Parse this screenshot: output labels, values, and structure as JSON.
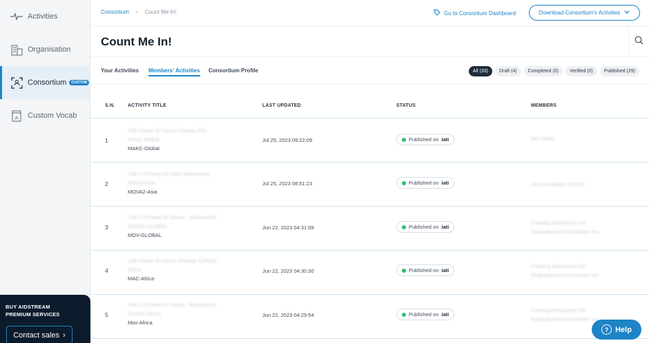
{
  "sidebar": {
    "items": [
      {
        "label": "Activities",
        "icon": "activity-pulse-icon"
      },
      {
        "label": "Organisation",
        "icon": "building-icon"
      },
      {
        "label": "Consortium",
        "icon": "consortium-icon",
        "badge": "CUSTOM",
        "active": true
      },
      {
        "label": "Custom Vocab",
        "icon": "vocab-book-icon"
      }
    ],
    "promo": {
      "title_line1": "BUY AIDSTREAM",
      "title_line2": "PREMIUM SERVICES",
      "button": "Contact sales"
    }
  },
  "header": {
    "breadcrumb": {
      "parent": "Consortium",
      "separator": "›",
      "current": "Count Me In!"
    },
    "dashboard_link": "Go to Consortium Dashboard",
    "download_button": "Download Consortium's Activities",
    "title": "Count Me In!"
  },
  "tabs": [
    "Your Activities",
    "Members' Activities",
    "Consortium Profile"
  ],
  "active_tab": "Members' Activities",
  "filters": [
    {
      "label": "All (33)",
      "active": true
    },
    {
      "label": "Draft (4)"
    },
    {
      "label": "Completed (0)"
    },
    {
      "label": "Verified (0)"
    },
    {
      "label": "Published (29)"
    }
  ],
  "table": {
    "columns": [
      "S.N.",
      "ACTIVITY TITLE",
      "LAST UPDATED",
      "STATUS",
      "MEMBERS"
    ],
    "rows": [
      {
        "sn": "1",
        "title_line1": "CMI Power of Voices-Change (Mo-",
        "title_line2": "mem)- Global",
        "identifier": "MAKC-Global",
        "updated": "Jul 25, 2023 09:22:09",
        "status": "Published on",
        "status_source": "iati",
        "member_line1": "WO-NWN",
        "member_line2": ""
      },
      {
        "sn": "2",
        "title_line1": "CMI 2.0 Power of Voice Movements",
        "title_line2": "(MOV)-Asia",
        "identifier": "MOVA2-Asia",
        "updated": "Jul 25, 2023 08:51:23",
        "status": "Published on",
        "status_source": "iati",
        "member_line1": "Just Associates (JASS)",
        "member_line2": ""
      },
      {
        "sn": "3",
        "title_line1": "CMI 2.0 Power of Voices - Movements",
        "title_line2": "(CREA)-GLOBAL",
        "identifier": "MOV-GLOBAL",
        "updated": "Jun 22, 2023 04:31:09",
        "status": "Published on",
        "status_source": "iati",
        "member_line1": "Creating Resources For",
        "member_line2": "Empowerment And Action Inc."
      },
      {
        "sn": "4",
        "title_line1": "CMI Power of Voices -Change (CREA) -",
        "title_line2": "Africa",
        "identifier": "MAC-Africa",
        "updated": "Jun 22, 2023 04:30:30",
        "status": "Published on",
        "status_source": "iati",
        "member_line1": "Creating Resources For",
        "member_line2": "Empowerment And Action Inc."
      },
      {
        "sn": "5",
        "title_line1": "CMI 2.0 Power of Voices - Movements",
        "title_line2": "(CREA)-Africa",
        "identifier": "Mov-Africa",
        "updated": "Jun 22, 2023 04:29:54",
        "status": "Published on",
        "status_source": "iati",
        "member_line1": "Creating Resources For",
        "member_line2": "Empowerment And Action Inc."
      }
    ]
  },
  "help_button": "Help",
  "colors": {
    "accent": "#1d84c6",
    "published_dot": "#2fbf71",
    "promo_bg": "#0b1b2b"
  }
}
